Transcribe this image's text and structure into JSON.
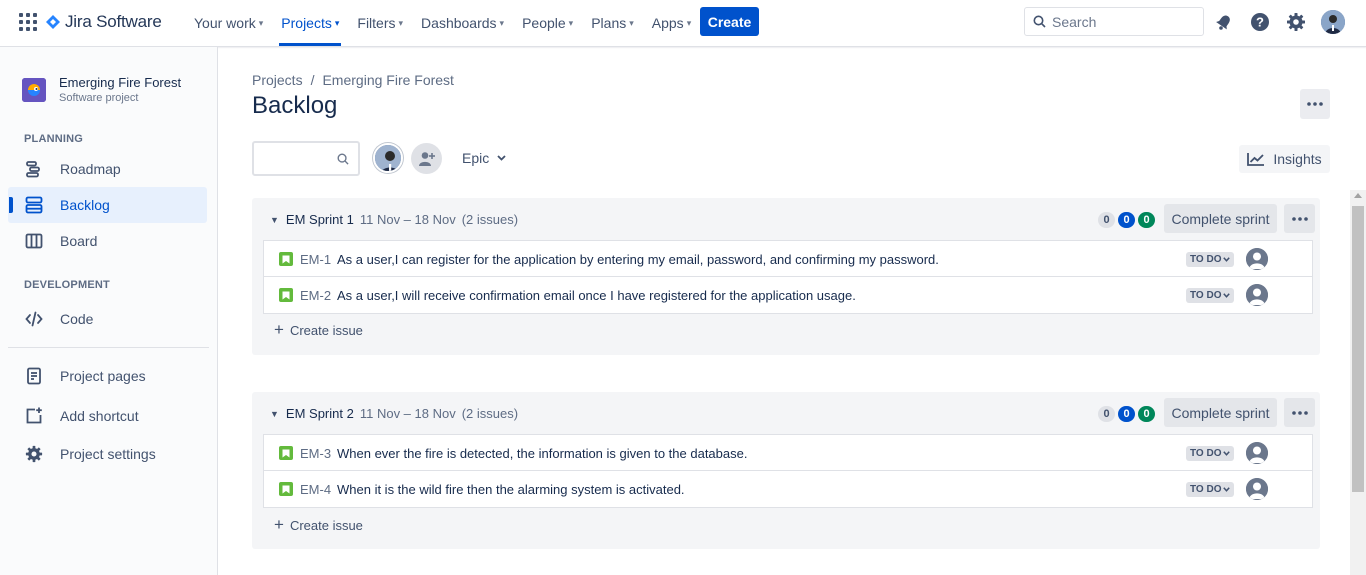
{
  "app": {
    "name": "Jira Software"
  },
  "nav": {
    "items": [
      {
        "label": "Your work",
        "active": false
      },
      {
        "label": "Projects",
        "active": true
      },
      {
        "label": "Filters",
        "active": false
      },
      {
        "label": "Dashboards",
        "active": false
      },
      {
        "label": "People",
        "active": false
      },
      {
        "label": "Plans",
        "active": false
      },
      {
        "label": "Apps",
        "active": false
      }
    ],
    "create_label": "Create",
    "search_placeholder": "Search"
  },
  "sidebar": {
    "project_name": "Emerging Fire Forest",
    "project_type": "Software project",
    "planning_title": "PLANNING",
    "development_title": "DEVELOPMENT",
    "items": [
      {
        "label": "Roadmap",
        "icon": "roadmap-icon",
        "active": false
      },
      {
        "label": "Backlog",
        "icon": "backlog-icon",
        "active": true
      },
      {
        "label": "Board",
        "icon": "board-icon",
        "active": false
      },
      {
        "label": "Code",
        "icon": "code-icon",
        "active": false
      },
      {
        "label": "Project pages",
        "icon": "pages-icon",
        "active": false
      },
      {
        "label": "Add shortcut",
        "icon": "add-shortcut-icon",
        "active": false
      },
      {
        "label": "Project settings",
        "icon": "gear-icon",
        "active": false
      }
    ]
  },
  "main": {
    "breadcrumb": [
      "Projects",
      "/",
      "Emerging Fire Forest"
    ],
    "title": "Backlog",
    "filter_search_value": "",
    "epic_label": "Epic",
    "insights_label": "Insights",
    "sprints": [
      {
        "name": "EM Sprint 1",
        "dates": "11 Nov – 18 Nov",
        "count": "(2 issues)",
        "counts": {
          "todo": "0",
          "in_progress": "0",
          "done": "0"
        },
        "complete_label": "Complete sprint",
        "issues": [
          {
            "key": "EM-1",
            "summary": "As a user,I can register for the application by entering my email, password, and confirming my password.",
            "status": "TO DO"
          },
          {
            "key": "EM-2",
            "summary": "As a user,I will receive confirmation email once I have registered for the application usage.",
            "status": "TO DO"
          }
        ],
        "create_label": "Create issue"
      },
      {
        "name": "EM Sprint 2",
        "dates": "11 Nov – 18 Nov",
        "count": "(2 issues)",
        "counts": {
          "todo": "0",
          "in_progress": "0",
          "done": "0"
        },
        "complete_label": "Complete sprint",
        "issues": [
          {
            "key": "EM-3",
            "summary": "When ever the fire is detected, the information is given to the database.",
            "status": "TO DO"
          },
          {
            "key": "EM-4",
            "summary": "When it is the wild fire then the alarming system is activated.",
            "status": "TO DO"
          }
        ],
        "create_label": "Create issue"
      }
    ]
  },
  "colors": {
    "brand": "#0052cc",
    "story": "#63ba3c",
    "done": "#00875a"
  }
}
